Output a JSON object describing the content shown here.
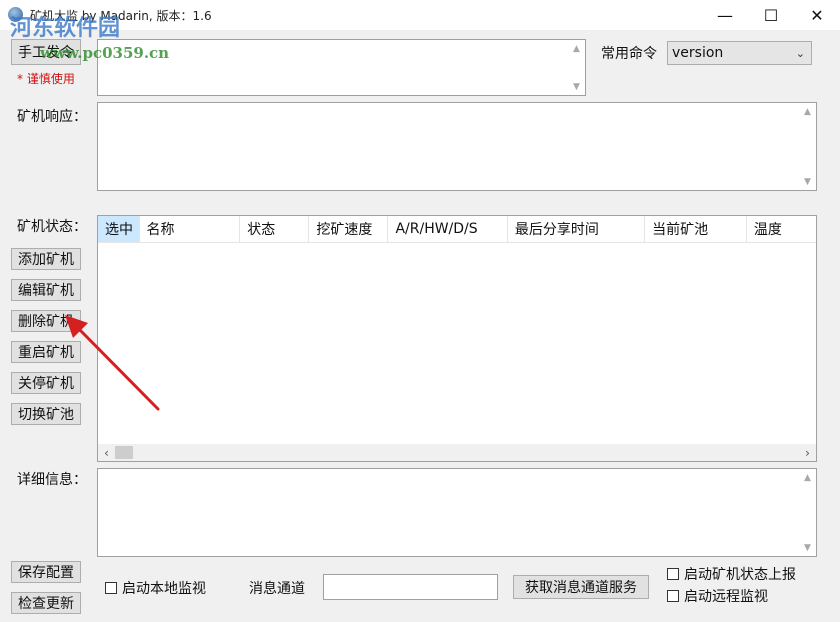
{
  "window": {
    "title": "矿机大监 by Madarin, 版本：1.6",
    "minimize": "—",
    "maximize": "☐",
    "close": "✕"
  },
  "watermark": {
    "line1": "河东软件园",
    "line2": "www.pc0359.cn"
  },
  "command": {
    "manual_button": "手工发令",
    "warning": "* 谨慎使用",
    "common_label": "常用命令",
    "common_value": "version"
  },
  "response": {
    "label": "矿机响应："
  },
  "status": {
    "label": "矿机状态：",
    "columns": [
      "选中",
      "名称",
      "状态",
      "挖矿速度",
      "A/R/HW/D/S",
      "最后分享时间",
      "当前矿池",
      "温度"
    ]
  },
  "actions": [
    "添加矿机",
    "编辑矿机",
    "删除矿机",
    "重启矿机",
    "关停矿机",
    "切换矿池"
  ],
  "detail": {
    "label": "详细信息："
  },
  "bottom": {
    "save_config": "保存配置",
    "check_update": "检查更新",
    "local_monitor": "启动本地监视",
    "channel_label": "消息通道",
    "channel_value": "",
    "get_service": "获取消息通道服务",
    "report_status": "启动矿机状态上报",
    "remote_monitor": "启动远程监视"
  },
  "colors": {
    "arrow": "#d42020",
    "selected_header": "#cce8ff",
    "focus_border": "#7aa7d9"
  }
}
